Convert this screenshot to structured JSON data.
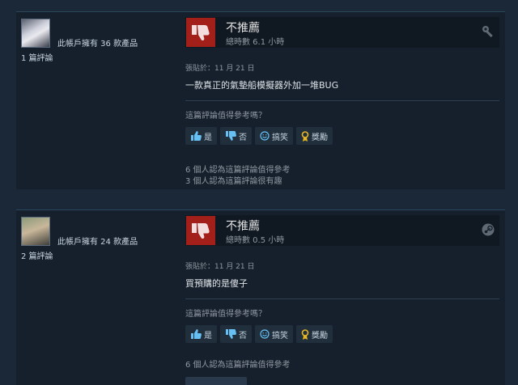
{
  "reviews": [
    {
      "owns_text": "此帳戶擁有 36 款產品",
      "reviews_text": "1 篇評論",
      "verdict": "不推薦",
      "hours": "總時數 6.1 小時",
      "posted": "張貼於：11 月 21 日",
      "content": "一款真正的氣墊船模擬器外加一堆BUG",
      "helpful_question": "這篇評論值得參考嗎？",
      "buttons": {
        "yes": "是",
        "no": "否",
        "funny": "搞笑",
        "award": "獎勵"
      },
      "stats": [
        "6 個人認為這篇評論值得參考",
        "3 個人認為這篇評論很有趣"
      ],
      "corner_icon": "wrench-icon"
    },
    {
      "owns_text": "此帳戶擁有 24 款產品",
      "reviews_text": "2 篇評論",
      "verdict": "不推薦",
      "hours": "總時數 0.5 小時",
      "posted": "張貼於：11 月 21 日",
      "content": "買預購的是傻子",
      "helpful_question": "這篇評論值得參考嗎？",
      "buttons": {
        "yes": "是",
        "no": "否",
        "funny": "搞笑",
        "award": "獎勵"
      },
      "stats": [
        "6 個人認為這篇評論值得參考"
      ],
      "corner_icon": "steam-icon"
    }
  ],
  "colors": {
    "thumb_down_bg": "#a3201a",
    "link_blue": "#66c0f4",
    "award_gold": "#e8b622"
  }
}
